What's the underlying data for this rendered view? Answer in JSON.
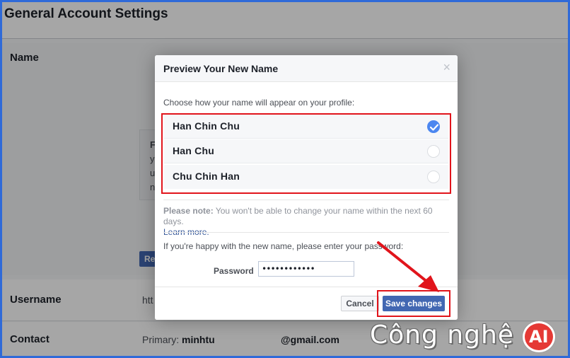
{
  "background": {
    "page_title": "General Account Settings",
    "rows": {
      "name_label": "Name",
      "username_label": "Username",
      "username_value": "htt",
      "contact_label": "Contact",
      "contact_primary_prefix": "Primary:",
      "contact_primary_user": "minhtu",
      "contact_email_suffix": "@gmail.com"
    },
    "inner_card_letters": [
      "F",
      "y",
      "u",
      "n"
    ],
    "review_button_fragment": "Re"
  },
  "dialog": {
    "title": "Preview Your New Name",
    "close_glyph": "×",
    "instruction": "Choose how your name will appear on your profile:",
    "options": [
      {
        "label": "Han Chin Chu",
        "selected": true
      },
      {
        "label": "Han Chu",
        "selected": false
      },
      {
        "label": "Chu Chin Han",
        "selected": false
      }
    ],
    "note_bold": "Please note:",
    "note_text": " You won't be able to change your name within the next 60 days.",
    "learn_more": "Learn more.",
    "confirm_text": "If you're happy with the new name, please enter your password:",
    "password_label": "Password",
    "password_value": "••••••••••••",
    "cancel_label": "Cancel",
    "save_label": "Save changes"
  },
  "colors": {
    "accent": "#4267b2",
    "highlight": "#e1141b",
    "checked": "#4c87f0",
    "frame": "#2f6ad8"
  },
  "watermark": {
    "text": "Công nghệ",
    "logo_text": "AI"
  }
}
